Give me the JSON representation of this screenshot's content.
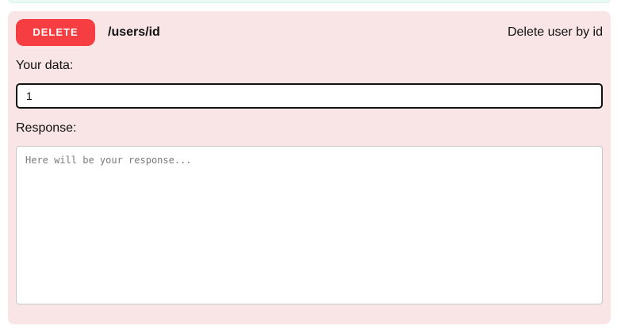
{
  "endpoint_card": {
    "method": "DELETE",
    "path": "/users/id",
    "description": "Delete user by id",
    "data_label": "Your data:",
    "data_value": "1",
    "response_label": "Response:",
    "response_placeholder": "Here will be your response...",
    "colors": {
      "card_background": "#f9e5e5",
      "method_badge": "#f63d41",
      "previous_card_background": "#eafaf5"
    }
  }
}
